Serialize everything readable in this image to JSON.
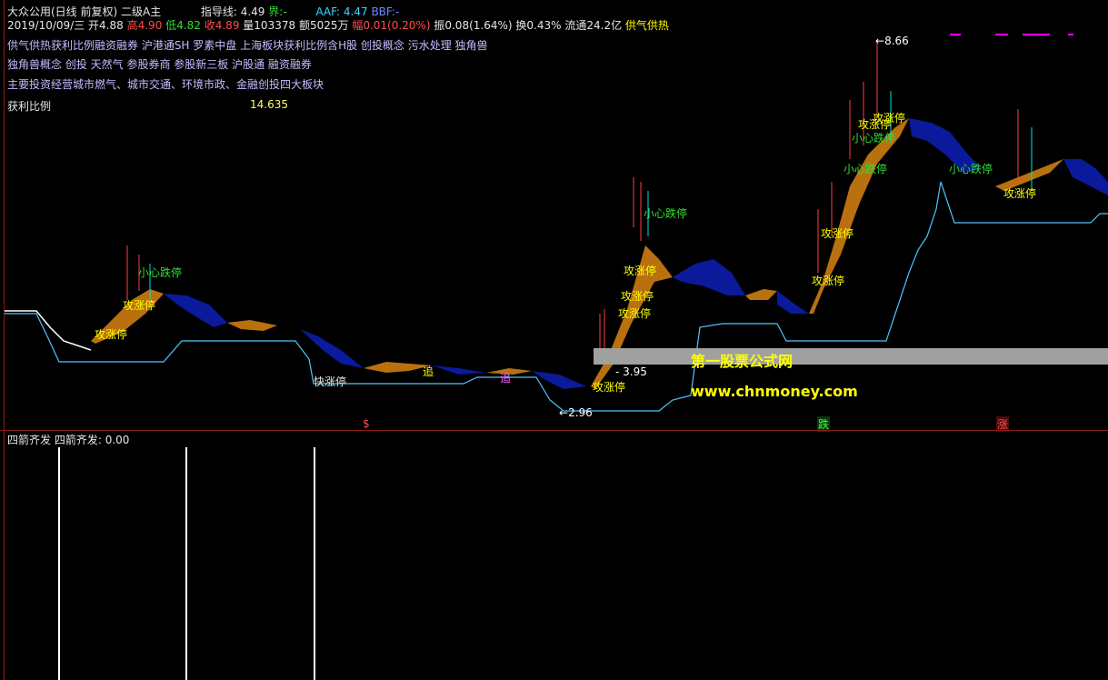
{
  "header": {
    "title": "大众公用(日线 前复权) 二级A主",
    "indicator_label": "指导线: 4.49",
    "jie_label": "界:",
    "jie_value": "-",
    "aaf_label": "AAF: 4.47",
    "bbf_label": "BBF:",
    "bbf_value": "-"
  },
  "quote": {
    "date": "2019/10/09/三",
    "open": "开4.88",
    "high": "高4.90",
    "low": "低4.82",
    "close": "收4.89",
    "volume": "量103378",
    "amount": "额5025万",
    "change": "幅0.01(0.20%)",
    "amplitude": "振0.08(1.64%)",
    "turnover": "换0.43%",
    "float_cap": "流通24.2亿",
    "concept": "供气供热"
  },
  "info_lines": [
    "供气供热获利比例融资融券 沪港通SH 罗素中盘 上海板块获利比例含H股 创投概念 污水处理 独角兽",
    "独角兽概念 创投 天然气 参股券商 参股新三板 沪股通 融资融券",
    "主要投资经营城市燃气、城市交通、环境市政、金融创投四大板块"
  ],
  "profit": {
    "label": "获利比例",
    "value": "14.635"
  },
  "chart_labels": {
    "max_price": "8.66",
    "min_price": "2.96",
    "mid_price": "3.95",
    "gong_zhangting": "攻涨停",
    "xiaoxin_dieting": "小心跌停",
    "kuaizhangtin": "快涨停",
    "zhui": "追",
    "jia": "追",
    "s_signal": "$",
    "die_signal": "跌",
    "zhang_signal": "涨"
  },
  "watermark": {
    "cn": "第一股票公式网",
    "url": "www.chnmoney.com"
  },
  "sub_chart": {
    "title": "四箭齐发",
    "value_label": "四箭齐发: 0.00"
  },
  "colors": {
    "up_band": "#b8710e",
    "down_band": "#0a1a9a",
    "support": "#4fc3ff",
    "candle_up": "#ff4040",
    "candle_down": "#00e0e0"
  },
  "chart_data": {
    "type": "line",
    "series": [
      {
        "name": "指导线",
        "values": [
          4.5,
          4.3,
          3.9,
          4.2,
          5.0,
          4.6,
          4.2,
          4.1,
          4.2,
          3.4,
          3.3,
          3.2,
          3.2,
          3.1,
          3.0,
          3.0,
          3.1,
          3.0,
          3.5,
          4.8,
          4.5,
          4.6,
          4.3,
          6.0,
          6.9,
          7.3,
          7.0,
          6.8,
          6.5,
          6.6
        ]
      }
    ],
    "ylim": [
      2.9,
      8.7
    ]
  }
}
